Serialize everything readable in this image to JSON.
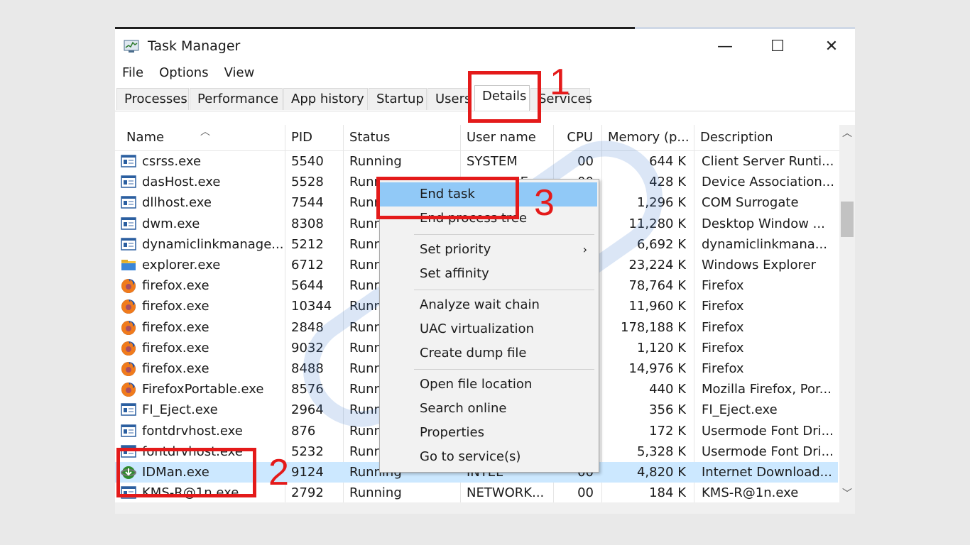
{
  "window": {
    "title": "Task Manager",
    "controls": {
      "minimize": "—",
      "maximize": "☐",
      "close": "✕"
    }
  },
  "menu": [
    "File",
    "Options",
    "View"
  ],
  "tabs": [
    "Processes",
    "Performance",
    "App history",
    "Startup",
    "Users",
    "Details",
    "Services"
  ],
  "active_tab": "Details",
  "columns": [
    "Name",
    "PID",
    "Status",
    "User name",
    "CPU",
    "Memory (p...",
    "Description"
  ],
  "rows": [
    {
      "name": "csrss.exe",
      "pid": "5540",
      "status": "Running",
      "user": "SYSTEM",
      "cpu": "00",
      "mem": "644 K",
      "desc": "Client Server Runti...",
      "icon": "window-app-icon"
    },
    {
      "name": "dasHost.exe",
      "pid": "5528",
      "status": "Runn",
      "user": "LOCAL SE",
      "cpu": "00",
      "mem": "428 K",
      "desc": "Device Association...",
      "icon": "window-app-icon"
    },
    {
      "name": "dllhost.exe",
      "pid": "7544",
      "status": "Runn",
      "user": "",
      "cpu": "",
      "mem": "1,296 K",
      "desc": "COM Surrogate",
      "icon": "window-app-icon"
    },
    {
      "name": "dwm.exe",
      "pid": "8308",
      "status": "Runn",
      "user": "",
      "cpu": "",
      "mem": "11,280 K",
      "desc": "Desktop Window ...",
      "icon": "window-app-icon"
    },
    {
      "name": "dynamiclinkmanage...",
      "pid": "5212",
      "status": "Runn",
      "user": "",
      "cpu": "",
      "mem": "6,692 K",
      "desc": "dynamiclinkmana...",
      "icon": "window-app-icon"
    },
    {
      "name": "explorer.exe",
      "pid": "6712",
      "status": "Runn",
      "user": "",
      "cpu": "",
      "mem": "23,224 K",
      "desc": "Windows Explorer",
      "icon": "folder-icon"
    },
    {
      "name": "firefox.exe",
      "pid": "5644",
      "status": "Runn",
      "user": "",
      "cpu": "",
      "mem": "78,764 K",
      "desc": "Firefox",
      "icon": "firefox-icon"
    },
    {
      "name": "firefox.exe",
      "pid": "10344",
      "status": "Runn",
      "user": "",
      "cpu": "",
      "mem": "11,960 K",
      "desc": "Firefox",
      "icon": "firefox-icon"
    },
    {
      "name": "firefox.exe",
      "pid": "2848",
      "status": "Runn",
      "user": "",
      "cpu": "",
      "mem": "178,188 K",
      "desc": "Firefox",
      "icon": "firefox-icon"
    },
    {
      "name": "firefox.exe",
      "pid": "9032",
      "status": "Runn",
      "user": "",
      "cpu": "",
      "mem": "1,120 K",
      "desc": "Firefox",
      "icon": "firefox-icon"
    },
    {
      "name": "firefox.exe",
      "pid": "8488",
      "status": "Runn",
      "user": "",
      "cpu": "",
      "mem": "14,976 K",
      "desc": "Firefox",
      "icon": "firefox-icon"
    },
    {
      "name": "FirefoxPortable.exe",
      "pid": "8576",
      "status": "Runn",
      "user": "",
      "cpu": "",
      "mem": "440 K",
      "desc": "Mozilla Firefox, Por...",
      "icon": "firefox-icon"
    },
    {
      "name": "FI_Eject.exe",
      "pid": "2964",
      "status": "Runn",
      "user": "",
      "cpu": "",
      "mem": "356 K",
      "desc": "FI_Eject.exe",
      "icon": "window-app-icon"
    },
    {
      "name": "fontdrvhost.exe",
      "pid": "876",
      "status": "Runn",
      "user": "",
      "cpu": "",
      "mem": "172 K",
      "desc": "Usermode Font Dri...",
      "icon": "window-app-icon"
    },
    {
      "name": "fontdrvhost.exe",
      "pid": "5232",
      "status": "Runn",
      "user": "",
      "cpu": "",
      "mem": "5,328 K",
      "desc": "Usermode Font Dri...",
      "icon": "window-app-icon"
    },
    {
      "name": "IDMan.exe",
      "pid": "9124",
      "status": "Running",
      "user": "INTEL",
      "cpu": "00",
      "mem": "4,820 K",
      "desc": "Internet Download...",
      "icon": "idm-icon",
      "selected": true
    },
    {
      "name": "KMS-R@1n.exe",
      "pid": "2792",
      "status": "Running",
      "user": "NETWORK...",
      "cpu": "00",
      "mem": "184 K",
      "desc": "KMS-R@1n.exe",
      "icon": "window-app-icon"
    }
  ],
  "context_menu": {
    "items": [
      {
        "label": "End task",
        "highlight": true
      },
      {
        "label": "End process tree"
      },
      {
        "sep": true
      },
      {
        "label": "Set priority",
        "submenu": true
      },
      {
        "label": "Set affinity"
      },
      {
        "sep": true
      },
      {
        "label": "Analyze wait chain"
      },
      {
        "label": "UAC virtualization"
      },
      {
        "label": "Create dump file"
      },
      {
        "sep": true
      },
      {
        "label": "Open file location"
      },
      {
        "label": "Search online"
      },
      {
        "label": "Properties"
      },
      {
        "label": "Go to service(s)"
      }
    ]
  },
  "annotations": {
    "step1": "1",
    "step2": "2",
    "step3": "3"
  },
  "colors": {
    "annotation": "#e41a1a",
    "selected_row": "#cce8ff",
    "menu_highlight": "#91c9f7"
  }
}
